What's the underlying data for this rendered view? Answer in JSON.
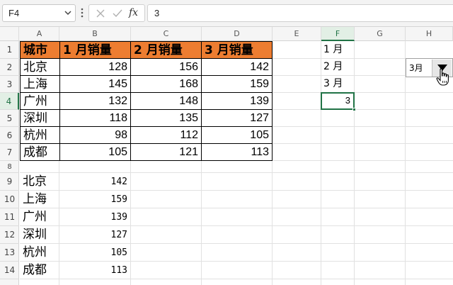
{
  "formula_bar": {
    "name_box": "F4",
    "fx_label": "fx",
    "content": "3"
  },
  "columns": [
    "A",
    "B",
    "C",
    "D",
    "E",
    "F",
    "G",
    "H"
  ],
  "rows": [
    "1",
    "2",
    "3",
    "4",
    "5",
    "6",
    "7",
    "8",
    "9",
    "10",
    "11",
    "12",
    "13",
    "14"
  ],
  "table": {
    "headers": [
      "城市",
      "1 月销量",
      "2 月销量",
      "3 月销量"
    ],
    "rows": [
      {
        "city": "北京",
        "m1": "128",
        "m2": "156",
        "m3": "142"
      },
      {
        "city": "上海",
        "m1": "145",
        "m2": "168",
        "m3": "159"
      },
      {
        "city": "广州",
        "m1": "132",
        "m2": "148",
        "m3": "139"
      },
      {
        "city": "深圳",
        "m1": "118",
        "m2": "135",
        "m3": "127"
      },
      {
        "city": "杭州",
        "m1": "98",
        "m2": "112",
        "m3": "105"
      },
      {
        "city": "成都",
        "m1": "105",
        "m2": "121",
        "m3": "113"
      }
    ]
  },
  "result_list": [
    {
      "city": "北京",
      "value": "142"
    },
    {
      "city": "上海",
      "value": "159"
    },
    {
      "city": "广州",
      "value": "139"
    },
    {
      "city": "深圳",
      "value": "127"
    },
    {
      "city": "杭州",
      "value": "105"
    },
    {
      "city": "成都",
      "value": "113"
    }
  ],
  "month_list": [
    "1 月",
    "2 月",
    "3 月"
  ],
  "active_cell_value": "3",
  "combo_box": {
    "value": "3月"
  },
  "colors": {
    "header_fill": "#ed7d31",
    "selection": "#217346"
  }
}
